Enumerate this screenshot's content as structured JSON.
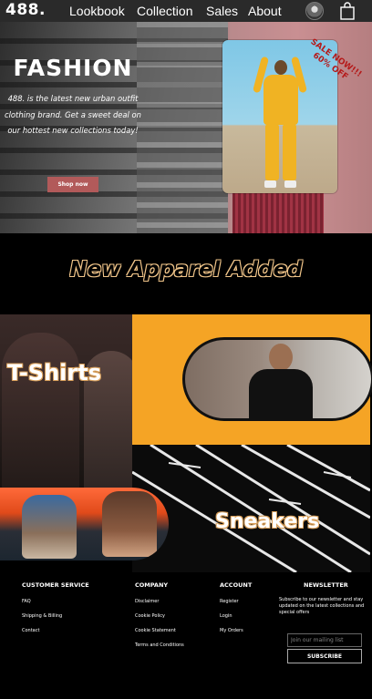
{
  "nav": {
    "logo": "488.",
    "links": [
      "Lookbook",
      "Collection",
      "Sales",
      "About"
    ],
    "icons": [
      "profile-avatar",
      "shopping-bag-icon"
    ]
  },
  "hero": {
    "title": "FASHION",
    "text": "488. is the latest new urban outfit clothing brand. Get a sweet deal on our hottest new collections today!",
    "button_label": "Shop now",
    "sale_badge": "SALE NOW!!! 60% OFF"
  },
  "new_section": {
    "heading": "New Apparel Added"
  },
  "categories": {
    "tshirts": "T-Shirts",
    "sneakers": "Sneakers"
  },
  "footer": {
    "customer_service": {
      "heading": "CUSTOMER SERVICE",
      "links": [
        "FAQ",
        "Shipping & Billing",
        "Contact"
      ]
    },
    "company": {
      "heading": "COMPANY",
      "links": [
        "Disclaimer",
        "Cookie Policy",
        "Cookie Statement",
        "Terms and Conditions"
      ]
    },
    "account": {
      "heading": "ACCOUNT",
      "links": [
        "Register",
        "Login",
        "My Orders"
      ]
    },
    "newsletter": {
      "heading": "NEWSLETTER",
      "text": "Subscribe to our newsletter and stay updated on the latest collections and special offers",
      "placeholder": "Join our mailing list",
      "button_label": "SUBSCRIBE"
    }
  },
  "colors": {
    "accent_orange": "#f5a425",
    "button_red": "#b25a5a",
    "sale_red": "#b51a1a"
  }
}
